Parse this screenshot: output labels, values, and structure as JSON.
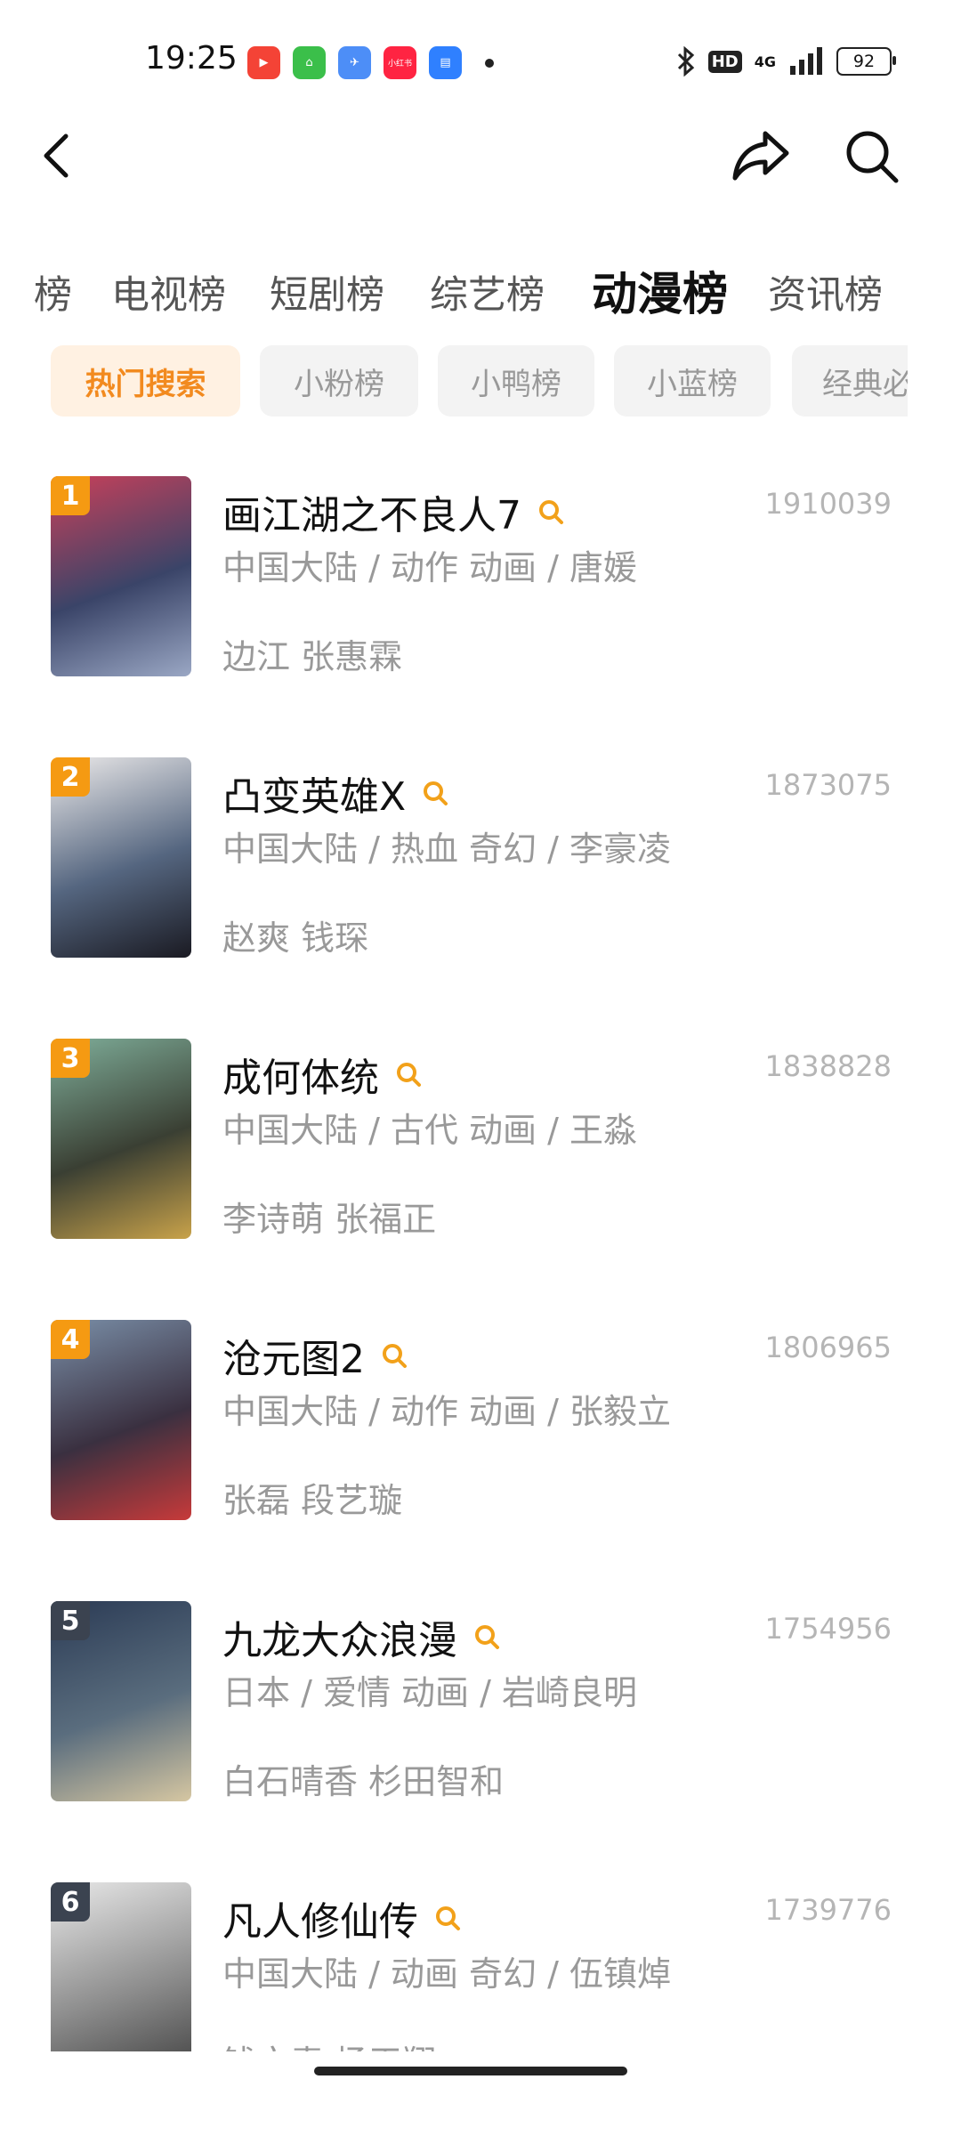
{
  "status_bar": {
    "time": "19:25",
    "network": "4G",
    "hd": "HD",
    "battery": "92",
    "app_icons": [
      {
        "name": "video-app-icon",
        "color": "#f44336",
        "glyph": "▶"
      },
      {
        "name": "green-app-icon",
        "color": "#3bbf4a",
        "glyph": "⌂"
      },
      {
        "name": "blue-bird-app-icon",
        "color": "#4d8ef7",
        "glyph": "✈"
      },
      {
        "name": "xiaohongshu-app-icon",
        "color": "#ff2442",
        "glyph": "小红书"
      },
      {
        "name": "calendar-app-icon",
        "color": "#2f80ff",
        "glyph": "▤"
      }
    ]
  },
  "category_tabs": [
    {
      "label": "榜",
      "active": false
    },
    {
      "label": "电视榜",
      "active": false
    },
    {
      "label": "短剧榜",
      "active": false
    },
    {
      "label": "综艺榜",
      "active": false
    },
    {
      "label": "动漫榜",
      "active": true
    },
    {
      "label": "资讯榜",
      "active": false
    }
  ],
  "sub_tabs": [
    {
      "label": "热门搜索",
      "active": true
    },
    {
      "label": "小粉榜",
      "active": false
    },
    {
      "label": "小鸭榜",
      "active": false
    },
    {
      "label": "小蓝榜",
      "active": false
    },
    {
      "label": "经典必",
      "active": false
    }
  ],
  "items": [
    {
      "rank": "1",
      "title": "画江湖之不良人7",
      "meta": "中国大陆 / 动作 动画 / 唐媛",
      "cast": "边江 张惠霖",
      "score": "1910039",
      "badge_color": "#f59a12",
      "poster": [
        "#c9405a",
        "#3a4468",
        "#9aa7c4"
      ]
    },
    {
      "rank": "2",
      "title": "凸变英雄X",
      "meta": "中国大陆 / 热血 奇幻 / 李豪凌",
      "cast": "赵爽 钱琛",
      "score": "1873075",
      "badge_color": "#f59a12",
      "poster": [
        "#eceaea",
        "#556680",
        "#1a1a22"
      ]
    },
    {
      "rank": "3",
      "title": "成何体统",
      "meta": "中国大陆 / 古代 动画 / 王淼",
      "cast": "李诗萌 张福正",
      "score": "1838828",
      "badge_color": "#f59a12",
      "poster": [
        "#7fae9a",
        "#3a3f33",
        "#c8a24a"
      ]
    },
    {
      "rank": "4",
      "title": "沧元图2",
      "meta": "中国大陆 / 动作 动画 / 张毅立",
      "cast": "张磊 段艺璇",
      "score": "1806965",
      "badge_color": "#f59a12",
      "poster": [
        "#7a8fa8",
        "#3a3040",
        "#c73a3a"
      ]
    },
    {
      "rank": "5",
      "title": "九龙大众浪漫",
      "meta": "日本 / 爱情 动画 / 岩崎良明",
      "cast": "白石晴香 杉田智和",
      "score": "1754956",
      "badge_color": "#3b4350",
      "poster": [
        "#2b3b55",
        "#5a6d7e",
        "#d6c7a2"
      ]
    },
    {
      "rank": "6",
      "title": "凡人修仙传",
      "meta": "中国大陆 / 动画 奇幻 / 伍镇焯",
      "cast": "钱文青 杨天翔",
      "score": "1739776",
      "badge_color": "#3b4350",
      "poster": [
        "#e8e8e8",
        "#8d8d8d",
        "#3e3e3e"
      ]
    }
  ]
}
